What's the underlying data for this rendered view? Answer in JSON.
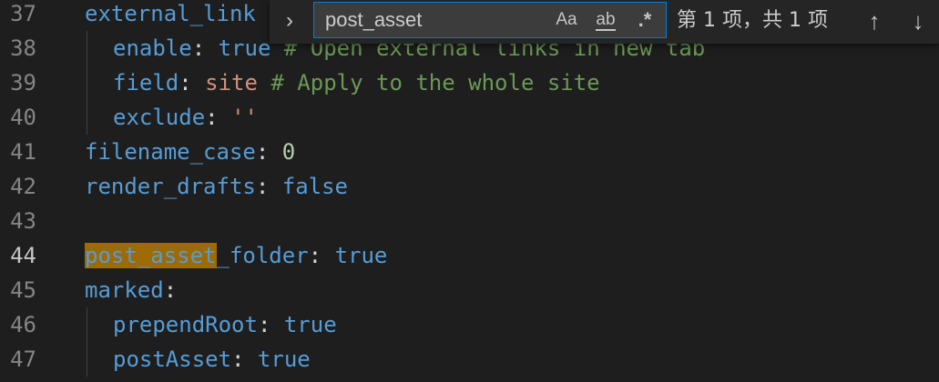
{
  "editor": {
    "lines": [
      {
        "num": "37",
        "indent": 0,
        "tokens": [
          [
            "external_link",
            "k"
          ]
        ]
      },
      {
        "num": "38",
        "indent": 1,
        "tokens": [
          [
            "enable",
            "k"
          ],
          [
            ": ",
            "p"
          ],
          [
            "true",
            "k"
          ],
          [
            " # Open external links in new tab",
            "c"
          ]
        ]
      },
      {
        "num": "39",
        "indent": 1,
        "tokens": [
          [
            "field",
            "k"
          ],
          [
            ": ",
            "p"
          ],
          [
            "site",
            "s"
          ],
          [
            " # Apply to the whole site",
            "c"
          ]
        ]
      },
      {
        "num": "40",
        "indent": 1,
        "tokens": [
          [
            "exclude",
            "k"
          ],
          [
            ": ",
            "p"
          ],
          [
            "''",
            "s"
          ]
        ]
      },
      {
        "num": "41",
        "indent": 0,
        "tokens": [
          [
            "filename_case",
            "k"
          ],
          [
            ": ",
            "p"
          ],
          [
            "0",
            "n"
          ]
        ]
      },
      {
        "num": "42",
        "indent": 0,
        "tokens": [
          [
            "render_drafts",
            "k"
          ],
          [
            ": ",
            "p"
          ],
          [
            "false",
            "k"
          ]
        ]
      },
      {
        "num": "43",
        "indent": 0,
        "tokens": []
      },
      {
        "num": "44",
        "indent": 0,
        "active": true,
        "tokens": [
          [
            "post_asset",
            "k match"
          ],
          [
            "_folder",
            "k"
          ],
          [
            ": ",
            "p"
          ],
          [
            "true",
            "k"
          ]
        ]
      },
      {
        "num": "45",
        "indent": 0,
        "tokens": [
          [
            "marked",
            "k"
          ],
          [
            ":",
            "p"
          ]
        ]
      },
      {
        "num": "46",
        "indent": 1,
        "tokens": [
          [
            "prependRoot",
            "k"
          ],
          [
            ": ",
            "p"
          ],
          [
            "true",
            "k"
          ]
        ]
      },
      {
        "num": "47",
        "indent": 1,
        "tokens": [
          [
            "postAsset",
            "k"
          ],
          [
            ": ",
            "p"
          ],
          [
            "true",
            "k"
          ]
        ]
      }
    ]
  },
  "find": {
    "toggle_replace_icon": "chevron-right-icon",
    "toggle_replace_glyph": "›",
    "query": "post_asset",
    "match_case_label": "Aa",
    "match_word_label": "ab",
    "regex_label": ".*",
    "result_count": "第 1 项，共 1 项",
    "prev_glyph": "↑",
    "next_glyph": "↓"
  },
  "colors": {
    "background": "#1e1e1e",
    "keyword": "#569cd6",
    "string": "#ce9178",
    "comment": "#6a9955",
    "number": "#b5cea8",
    "match_highlight": "#9e6a03",
    "find_border": "#007fd4"
  }
}
